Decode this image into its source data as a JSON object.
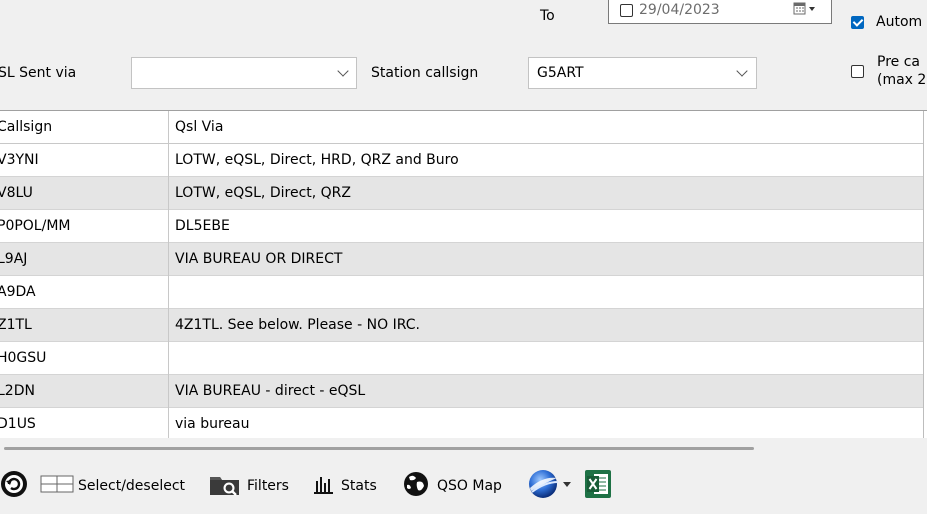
{
  "filters": {
    "to_label": "To",
    "to_date": "29/04/2023",
    "automatic_label": "Autom",
    "qsl_sent_via_label": "SL Sent via",
    "qsl_sent_via_value": "",
    "station_callsign_label": "Station callsign",
    "station_callsign_value": "G5ART",
    "pre_label_line1": "Pre ca",
    "pre_label_line2": "(max 2"
  },
  "table": {
    "columns": [
      "Callsign",
      "Qsl Via"
    ],
    "rows": [
      {
        "callsign": "V3YNI",
        "qsl_via": "LOTW, eQSL, Direct, HRD, QRZ and Buro"
      },
      {
        "callsign": "V8LU",
        "qsl_via": "LOTW, eQSL, Direct, QRZ"
      },
      {
        "callsign": "P0POL/MM",
        "qsl_via": "DL5EBE"
      },
      {
        "callsign": "L9AJ",
        "qsl_via": "VIA BUREAU OR DIRECT"
      },
      {
        "callsign": "A9DA",
        "qsl_via": ""
      },
      {
        "callsign": "Z1TL",
        "qsl_via": "4Z1TL. See below. Please - NO IRC."
      },
      {
        "callsign": "H0GSU",
        "qsl_via": ""
      },
      {
        "callsign": "L2DN",
        "qsl_via": "VIA BUREAU - direct - eQSL"
      },
      {
        "callsign": "D1US",
        "qsl_via": "via bureau"
      }
    ]
  },
  "toolbar": {
    "select_deselect": "Select/deselect",
    "filters": "Filters",
    "stats": "Stats",
    "qso_map": "QSO Map",
    "icons": [
      "refresh-icon",
      "grid-icon",
      "folder-search-icon",
      "bar-chart-icon",
      "globe-icon",
      "google-earth-icon",
      "excel-icon"
    ]
  }
}
